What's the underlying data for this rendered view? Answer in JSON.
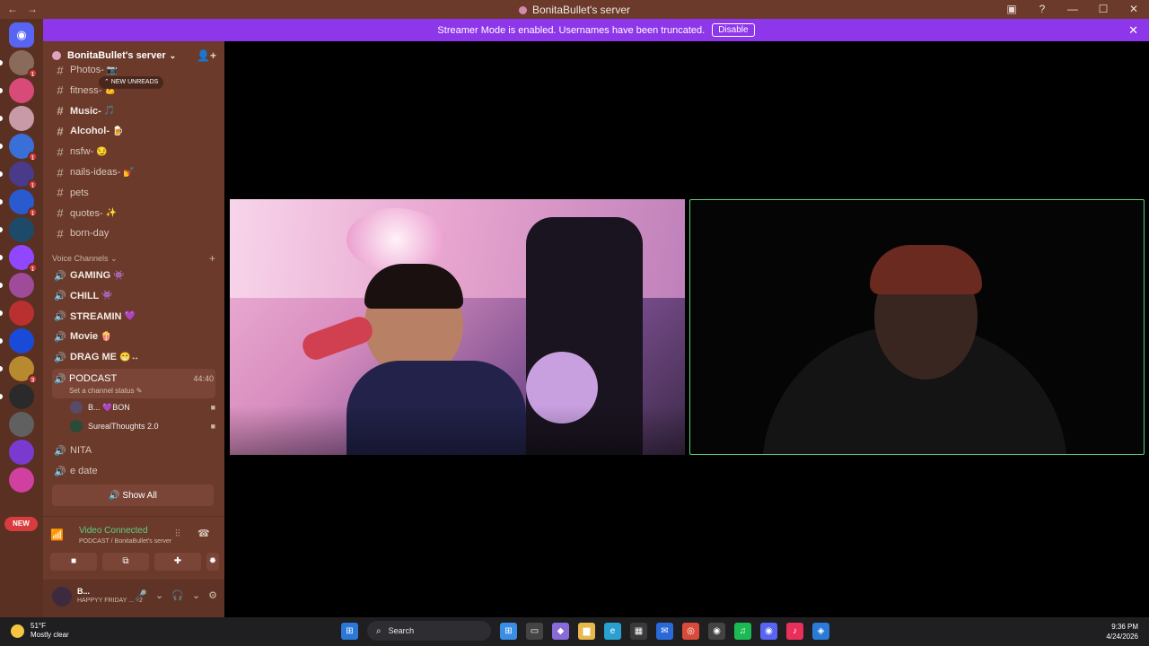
{
  "titlebar": {
    "title": "BonitaBullet's server",
    "back": "←",
    "forward": "→",
    "controls": [
      "▣",
      "?",
      "—",
      "☐",
      "✕"
    ]
  },
  "banner": {
    "text": "Streamer Mode is enabled. Usernames have been truncated.",
    "button": "Disable",
    "close": "✕"
  },
  "guilds": [
    {
      "color": "#5865f2",
      "badge": "",
      "glyph": "◉"
    },
    {
      "color": "#8a6a5a",
      "badge": "1"
    },
    {
      "color": "#d84a78",
      "badge": ""
    },
    {
      "color": "#c89aa8",
      "badge": ""
    },
    {
      "color": "#3a6fd8",
      "badge": "1"
    },
    {
      "color": "#4a3a8a",
      "badge": "1"
    },
    {
      "color": "#2a5ad0",
      "badge": "1"
    },
    {
      "color": "#1e4a6a",
      "badge": ""
    },
    {
      "color": "#9146ff",
      "badge": "1"
    },
    {
      "color": "#a04a9a",
      "badge": ""
    },
    {
      "color": "#b83030",
      "badge": ""
    },
    {
      "color": "#1a4ad8",
      "badge": ""
    },
    {
      "color": "#b88a30",
      "badge": "3"
    },
    {
      "color": "#2a2a2a",
      "badge": ""
    },
    {
      "color": "#606060",
      "badge": ""
    },
    {
      "color": "#7a3ad0",
      "badge": ""
    },
    {
      "color": "#d040a0",
      "badge": ""
    }
  ],
  "new_pill": "NEW",
  "server": {
    "name": "BonitaBullet's server",
    "chev": "⌄",
    "invite": "👤+"
  },
  "unreads_pill": "⌃ NEW UNREADS",
  "text_channels": [
    {
      "name": "Photos-",
      "emoji": "📷",
      "bold": false
    },
    {
      "name": "fitness-",
      "emoji": "💪",
      "bold": false
    },
    {
      "name": "Music-",
      "emoji": "🎵",
      "bold": true
    },
    {
      "name": "Alcohol-",
      "emoji": "🍺",
      "bold": true
    },
    {
      "name": "nsfw-",
      "emoji": "😏",
      "bold": false
    },
    {
      "name": "nails-ideas-",
      "emoji": "💅",
      "bold": false
    },
    {
      "name": "pets",
      "emoji": "",
      "bold": false
    },
    {
      "name": "quotes-",
      "emoji": "✨",
      "bold": false
    },
    {
      "name": "born-day",
      "emoji": "",
      "bold": false
    }
  ],
  "voice_section": {
    "title": "Voice Channels ⌄",
    "plus": "+"
  },
  "voice_channels_top": [
    {
      "name": "GAMING",
      "emoji": "👾"
    },
    {
      "name": "CHILL",
      "emoji": "👾"
    },
    {
      "name": "STREAMIN",
      "emoji": "💜"
    },
    {
      "name": "Movie",
      "emoji": "🍿"
    },
    {
      "name": "DRAG ME",
      "emoji": "😁↔"
    }
  ],
  "podcast": {
    "name": "PODCAST",
    "status": "Set a channel status ✎",
    "timer": "44:40",
    "icon": "🔊"
  },
  "voice_users": [
    {
      "name": "B...  💜BON",
      "av": "#5a4a6a",
      "cam": "■"
    },
    {
      "name": "SurealThoughts 2.0",
      "av": "#2a4a3a",
      "cam": "■"
    }
  ],
  "voice_channels_bottom": [
    {
      "name": "NITA"
    },
    {
      "name": "e date"
    }
  ],
  "show_all": "🔊 Show All",
  "vc": {
    "title": "Video Connected",
    "sub": "PODCAST / BonitaBullet's server",
    "wifi": "📶",
    "ctl1": "⫶⫶",
    "ctl2": "☎"
  },
  "vc_buttons": [
    "■",
    "⧉",
    "✚",
    "✹"
  ],
  "user": {
    "name": "B...",
    "status": "HAPPYY FRIDAY ...  +2",
    "icons": [
      "🎤",
      "⌄",
      "🎧",
      "⌄",
      "⚙"
    ]
  },
  "taskbar": {
    "temp": "51°F",
    "weather": "Mostly clear",
    "search": "Search",
    "time": "9:36 PM",
    "date": "4/24/2026",
    "apps": [
      {
        "glyph": "⊞",
        "color": "#3a8ee6"
      },
      {
        "glyph": "▭",
        "color": "#444"
      },
      {
        "glyph": "◆",
        "color": "#8a6ad8"
      },
      {
        "glyph": "▆",
        "color": "#e8b84a"
      },
      {
        "glyph": "e",
        "color": "#2aa0d0"
      },
      {
        "glyph": "▦",
        "color": "#3a3a3a"
      },
      {
        "glyph": "✉",
        "color": "#2a6ad8"
      },
      {
        "glyph": "◎",
        "color": "#d84a3a"
      },
      {
        "glyph": "◉",
        "color": "#444"
      },
      {
        "glyph": "♫",
        "color": "#1db954"
      },
      {
        "glyph": "◉",
        "color": "#5865f2"
      },
      {
        "glyph": "♪",
        "color": "#e8305a"
      },
      {
        "glyph": "◈",
        "color": "#2a7ad8"
      }
    ]
  }
}
